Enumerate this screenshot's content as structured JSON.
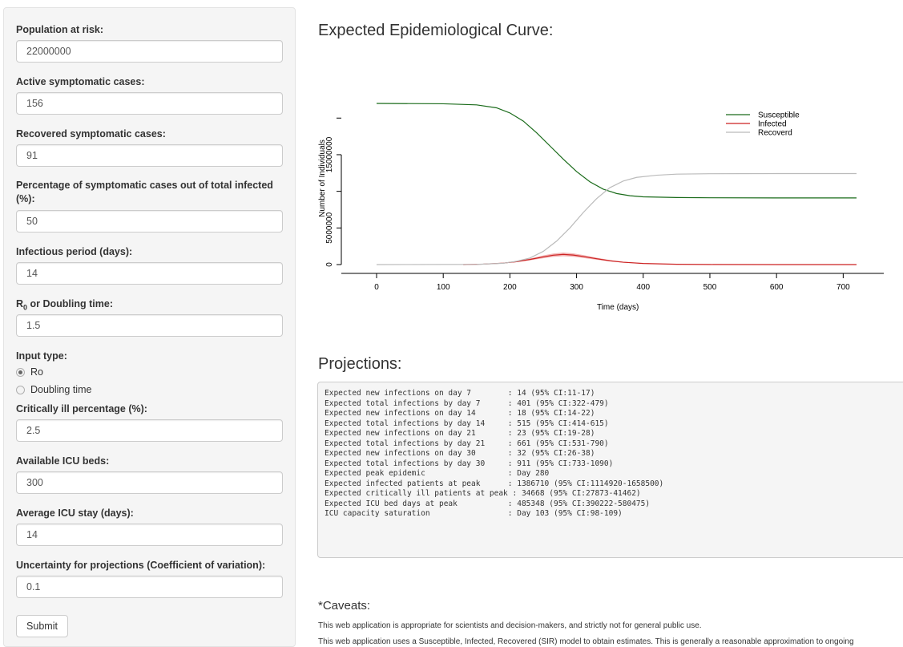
{
  "sidebar": {
    "fields": [
      {
        "label": "Population at risk:",
        "value": "22000000"
      },
      {
        "label": "Active symptomatic cases:",
        "value": "156"
      },
      {
        "label": "Recovered symptomatic cases:",
        "value": "91"
      },
      {
        "label": "Percentage of symptomatic cases out of total infected (%):",
        "value": "50"
      },
      {
        "label": "Infectious period (days):",
        "value": "14"
      },
      {
        "label_main": "R",
        "label_sub": "0",
        "label_rest": " or Doubling time:",
        "value": "1.5"
      }
    ],
    "input_type": {
      "label": "Input type:",
      "options": [
        {
          "label": "Ro",
          "checked": true
        },
        {
          "label": "Doubling time",
          "checked": false
        }
      ]
    },
    "fields2": [
      {
        "label": "Critically ill percentage (%):",
        "value": "2.5"
      },
      {
        "label": "Available ICU beds:",
        "value": "300"
      },
      {
        "label": "Average ICU stay (days):",
        "value": "14"
      },
      {
        "label": "Uncertainty for projections (Coefficient of variation):",
        "value": "0.1"
      }
    ],
    "submit_label": "Submit"
  },
  "main": {
    "curve_title": "Expected Epidemiological Curve:",
    "projections_title": "Projections:",
    "projections": [
      "Expected new infections on day 7        : 14 (95% CI:11-17)",
      "Expected total infections by day 7      : 401 (95% CI:322-479)",
      "Expected new infections on day 14       : 18 (95% CI:14-22)",
      "Expected total infections by day 14     : 515 (95% CI:414-615)",
      "Expected new infections on day 21       : 23 (95% CI:19-28)",
      "Expected total infections by day 21     : 661 (95% CI:531-790)",
      "Expected new infections on day 30       : 32 (95% CI:26-38)",
      "Expected total infections by day 30     : 911 (95% CI:733-1090)",
      "Expected peak epidemic                  : Day 280",
      "Expected infected patients at peak      : 1386710 (95% CI:1114920-1658500)",
      "Expected critically ill patients at peak : 34668 (95% CI:27873-41462)",
      "Expected ICU bed days at peak           : 485348 (95% CI:390222-580475)",
      "ICU capacity saturation                 : Day 103 (95% CI:98-109)"
    ],
    "caveats_title": "*Caveats:",
    "caveats": [
      "This web application is appropriate for scientists and decision-makers, and strictly not for general public use.",
      "This web application uses a Susceptible, Infected, Recovered (SIR) model to obtain estimates. This is generally a reasonable approximation to ongoing"
    ]
  },
  "chart_data": {
    "type": "line",
    "xlabel": "Time (days)",
    "ylabel": "Number of Individuals",
    "xlim": [
      0,
      720
    ],
    "ylim": [
      0,
      22000000
    ],
    "x_ticks": [
      0,
      100,
      200,
      300,
      400,
      500,
      600,
      700
    ],
    "y_ticks": [
      0,
      5000000,
      15000000
    ],
    "y_tick_labels": [
      "0",
      "5000000",
      "15000000"
    ],
    "legend_position": "top-right",
    "series": [
      {
        "name": "Susceptible",
        "color": "#1a6b1a",
        "x": [
          0,
          100,
          150,
          180,
          200,
          220,
          240,
          260,
          280,
          300,
          320,
          340,
          360,
          380,
          400,
          450,
          500,
          600,
          720
        ],
        "y": [
          22000000,
          21950000,
          21800000,
          21400000,
          20700000,
          19600000,
          18000000,
          16200000,
          14400000,
          12700000,
          11300000,
          10300000,
          9700000,
          9400000,
          9250000,
          9150000,
          9120000,
          9100000,
          9100000
        ]
      },
      {
        "name": "Infected",
        "color": "#cc2222",
        "band_color": "#f2b3b3",
        "x": [
          130,
          160,
          190,
          210,
          230,
          250,
          265,
          280,
          295,
          310,
          330,
          350,
          370,
          400,
          450,
          500,
          600,
          720
        ],
        "y": [
          0,
          60000,
          200000,
          400000,
          700000,
          1050000,
          1280000,
          1386710,
          1300000,
          1100000,
          800000,
          520000,
          320000,
          150000,
          40000,
          10000,
          0,
          0
        ],
        "band_width": 250000
      },
      {
        "name": "Recoverd",
        "color": "#bbbbbb",
        "x": [
          0,
          150,
          190,
          210,
          230,
          250,
          270,
          290,
          310,
          330,
          350,
          370,
          390,
          420,
          450,
          500,
          600,
          720
        ],
        "y": [
          0,
          30000,
          180000,
          450000,
          900000,
          1800000,
          3200000,
          5000000,
          7100000,
          9000000,
          10500000,
          11400000,
          11900000,
          12200000,
          12350000,
          12400000,
          12420000,
          12420000
        ]
      }
    ]
  }
}
